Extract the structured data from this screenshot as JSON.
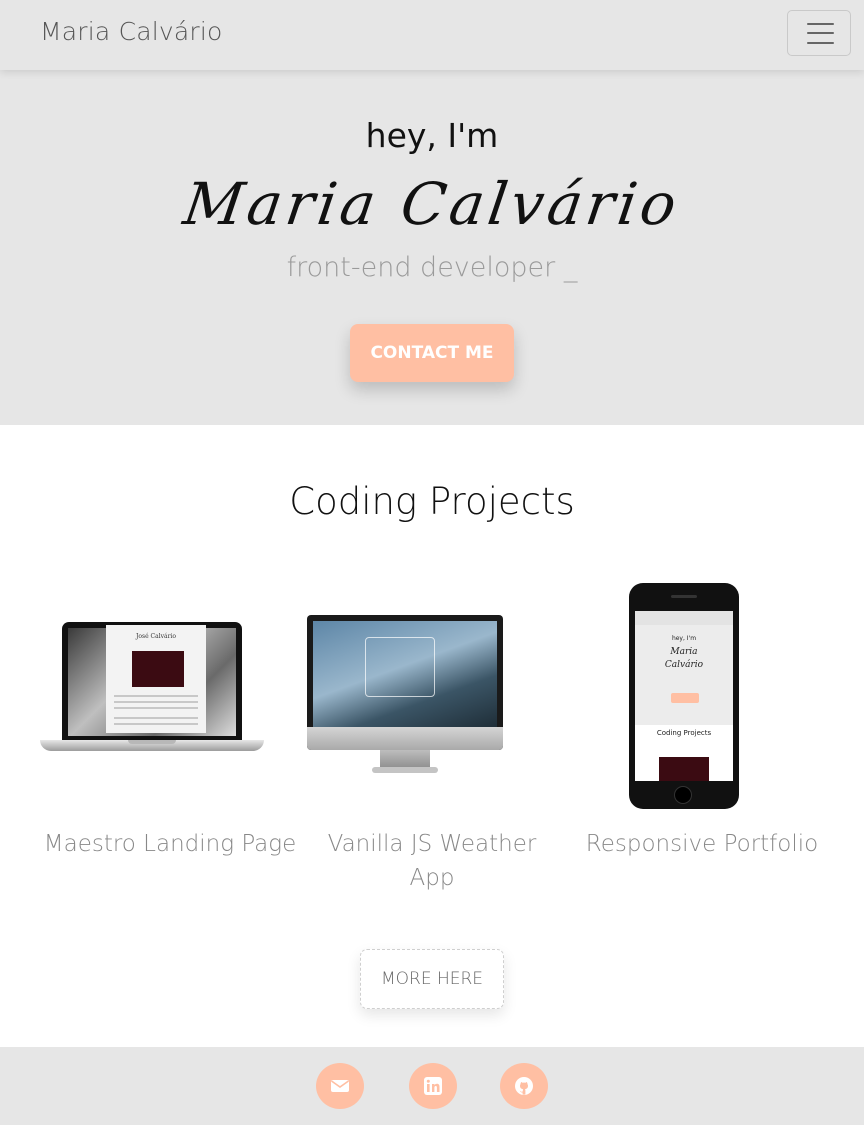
{
  "navbar": {
    "brand": "Maria Calvário",
    "menu_icon": "hamburger-menu-icon"
  },
  "hero": {
    "greeting": "hey, I'm",
    "name": "Maria Calvário",
    "role": "front-end developer _",
    "cta_label": "CONTACT ME"
  },
  "projects": {
    "title": "Coding Projects",
    "items": [
      {
        "title": "Maestro Landing Page",
        "device": "laptop"
      },
      {
        "title": "Vanilla JS Weather App",
        "device": "monitor"
      },
      {
        "title": "Responsive Portfolio",
        "device": "phone"
      }
    ],
    "more_label": "MORE HERE"
  },
  "footer": {
    "icons": [
      "envelope-icon",
      "linkedin-icon",
      "github-icon"
    ]
  },
  "colors": {
    "accent": "#ffbfa3",
    "background": "#e6e6e6",
    "text_muted": "#888888"
  }
}
